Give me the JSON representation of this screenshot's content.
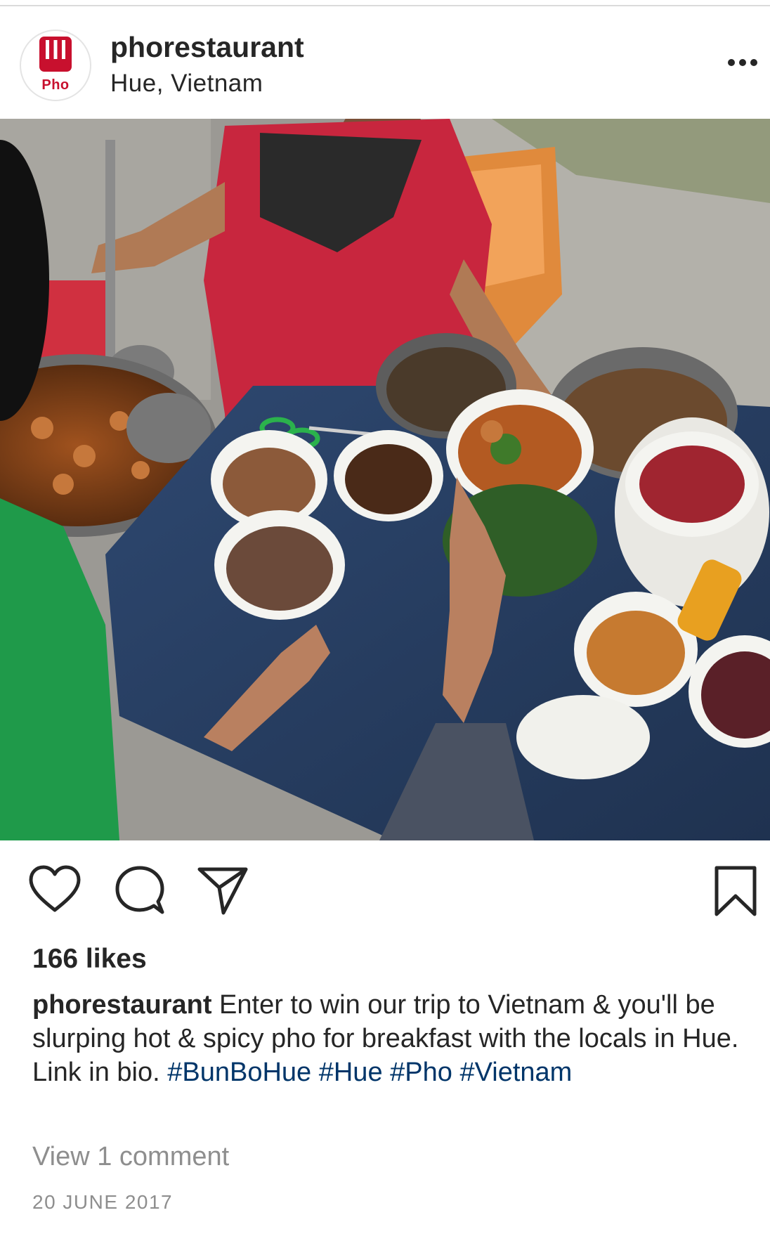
{
  "header": {
    "username": "phorestaurant",
    "location": "Hue, Vietnam",
    "avatar_text": "Pho",
    "more_icon": "ellipsis-horizontal-icon"
  },
  "photo": {
    "icons": [
      "ladle-icon",
      "bowl-icon",
      "scissors-icon",
      "pot-icon"
    ]
  },
  "actions": {
    "like_icon": "heart-outline-icon",
    "comment_icon": "speech-bubble-icon",
    "share_icon": "paper-plane-icon",
    "save_icon": "bookmark-outline-icon"
  },
  "likes_text": "166 likes",
  "caption": {
    "username": "phorestaurant",
    "text": "Enter to win our trip to Vietnam & you'll be slurping hot & spicy pho for breakfast with the locals in Hue. Link in bio.",
    "hashtags": [
      "#BunBoHue",
      "#Hue",
      "#Pho",
      "#Vietnam"
    ]
  },
  "view_comments": "View 1 comment",
  "date": "20 JUNE 2017",
  "colors": {
    "brand_red": "#c8102e",
    "hashtag_blue": "#003569",
    "text_primary": "#262626",
    "text_secondary": "#8e8e8e"
  }
}
